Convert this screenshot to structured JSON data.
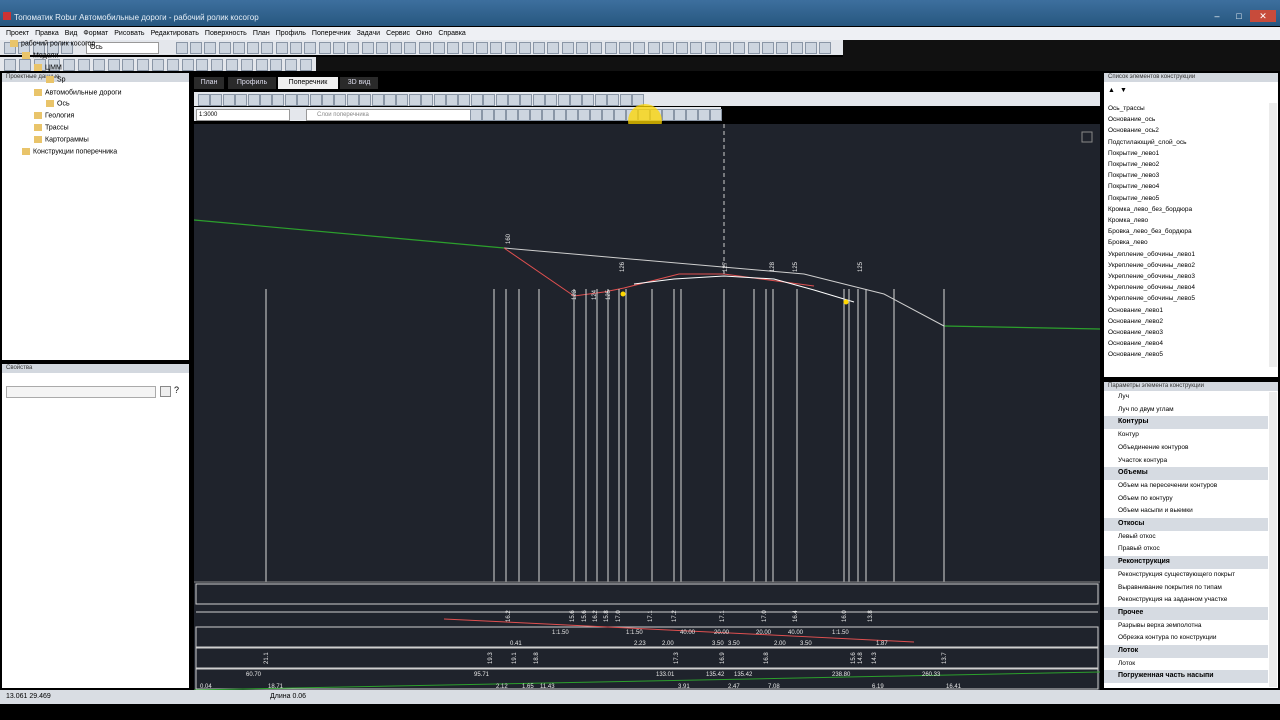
{
  "window": {
    "title": "Топоматик Robur Автомобильные дороги - рабочий ролик косогор"
  },
  "menu": [
    "Проект",
    "Правка",
    "Вид",
    "Формат",
    "Рисовать",
    "Редактировать",
    "Поверхность",
    "План",
    "Профиль",
    "Поперечник",
    "Задачи",
    "Сервис",
    "Окно",
    "Справка"
  ],
  "toolbar": {
    "layer_value": "Ось"
  },
  "project_tree": {
    "header": "Проектные данные",
    "items": [
      {
        "label": "рабочий ролик косогор",
        "level": 0
      },
      {
        "label": "Модели",
        "level": 1
      },
      {
        "label": "ЦММ",
        "level": 2
      },
      {
        "label": "Sp",
        "level": 3
      },
      {
        "label": "Автомобильные дороги",
        "level": 2
      },
      {
        "label": "Ось",
        "level": 3
      },
      {
        "label": "Геология",
        "level": 2
      },
      {
        "label": "Трассы",
        "level": 2
      },
      {
        "label": "Картограммы",
        "level": 2
      },
      {
        "label": "Конструкции поперечника",
        "level": 1
      }
    ]
  },
  "properties": {
    "header": "Свойства"
  },
  "tabs": [
    "План",
    "Профиль",
    "Поперечник",
    "3D вид"
  ],
  "scale": {
    "value": "1:3000"
  },
  "layer_filter": {
    "placeholder": "Слои поперечника"
  },
  "layers_list": {
    "header": "Список элементов конструкции",
    "items": [
      "Ось_трассы",
      "Основание_ось",
      "Основание_ось2",
      "Подстилающий_слой_ось",
      "Покрытие_лево1",
      "Покрытие_лево2",
      "Покрытие_лево3",
      "Покрытие_лево4",
      "Покрытие_лево5",
      "Кромка_лево_без_бордюра",
      "Кромка_лево",
      "Бровка_лево_без_бордюра",
      "Бровка_лево",
      "Укрепление_обочины_лево1",
      "Укрепление_обочины_лево2",
      "Укрепление_обочины_лево3",
      "Укрепление_обочины_лево4",
      "Укрепление_обочины_лево5",
      "Основание_лево1",
      "Основание_лево2",
      "Основание_лево3",
      "Основание_лево4",
      "Основание_лево5"
    ]
  },
  "tools": {
    "header": "Параметры элемента конструкции",
    "entries": [
      {
        "type": "item",
        "label": "Луч"
      },
      {
        "type": "item",
        "label": "Луч по двум углам"
      },
      {
        "type": "group",
        "label": "Контуры"
      },
      {
        "type": "item",
        "label": "Контур"
      },
      {
        "type": "item",
        "label": "Объединение контуров"
      },
      {
        "type": "item",
        "label": "Участок контура"
      },
      {
        "type": "group",
        "label": "Объемы"
      },
      {
        "type": "item",
        "label": "Объем на пересечении контуров"
      },
      {
        "type": "item",
        "label": "Объем по контуру"
      },
      {
        "type": "item",
        "label": "Объем насыпи и выемки"
      },
      {
        "type": "group",
        "label": "Откосы"
      },
      {
        "type": "item",
        "label": "Левый откос"
      },
      {
        "type": "item",
        "label": "Правый откос"
      },
      {
        "type": "group",
        "label": "Реконструкция"
      },
      {
        "type": "item",
        "label": "Реконструкция существующего покрыт"
      },
      {
        "type": "item",
        "label": "Выравнивание покрытия по типам"
      },
      {
        "type": "item",
        "label": "Реконструкция на заданном участке"
      },
      {
        "type": "group",
        "label": "Прочее"
      },
      {
        "type": "item",
        "label": "Разрывы верха земполотна"
      },
      {
        "type": "item",
        "label": "Обрезка контура по конструкции"
      },
      {
        "type": "group",
        "label": "Лоток"
      },
      {
        "type": "item",
        "label": "Лоток"
      },
      {
        "type": "group",
        "label": "Погруженная часть насыпи"
      }
    ]
  },
  "drawing": {
    "top_labels": [
      "160",
      "123",
      "124",
      "125",
      "126",
      "127",
      "128",
      "125",
      "125"
    ],
    "row1_labels": [
      "16.2",
      "15.6",
      "15.6",
      "16.2",
      "15.8",
      "17.0",
      "17.1",
      "17.2",
      "17.1",
      "17.0",
      "16.4",
      "16.0",
      "13.8"
    ],
    "row2_values": [
      "1:1.50",
      "1:1.50",
      "40.00",
      "20.00",
      "20.00",
      "40.00",
      "1:1.50"
    ],
    "row3_values": [
      "0.41",
      "2.23",
      "2.00",
      "3.50",
      "3.50",
      "2.00",
      "3.50",
      "1.87"
    ],
    "bottom_row1": [
      "60.70",
      "95.71",
      "133.01",
      "135.42",
      "135.42",
      "238.80",
      "260.33"
    ],
    "bottom_row2": [
      "0.04",
      "18.71",
      "2.12",
      "1.65",
      "11.43",
      "3.91",
      "2.47",
      "7.08",
      "6.19",
      "16.41"
    ],
    "vertical_labels": [
      "21.1",
      "19.3",
      "19.1",
      "18.8",
      "17.3",
      "16.9",
      "16.8",
      "15.6",
      "14.8",
      "14.3",
      "13.7"
    ]
  },
  "status": {
    "coords": "13.061  29.469",
    "length": "Длина  0.06"
  },
  "colors": {
    "ground": "#2ca02c",
    "design": "#e05050",
    "accent": "#ffd700"
  }
}
